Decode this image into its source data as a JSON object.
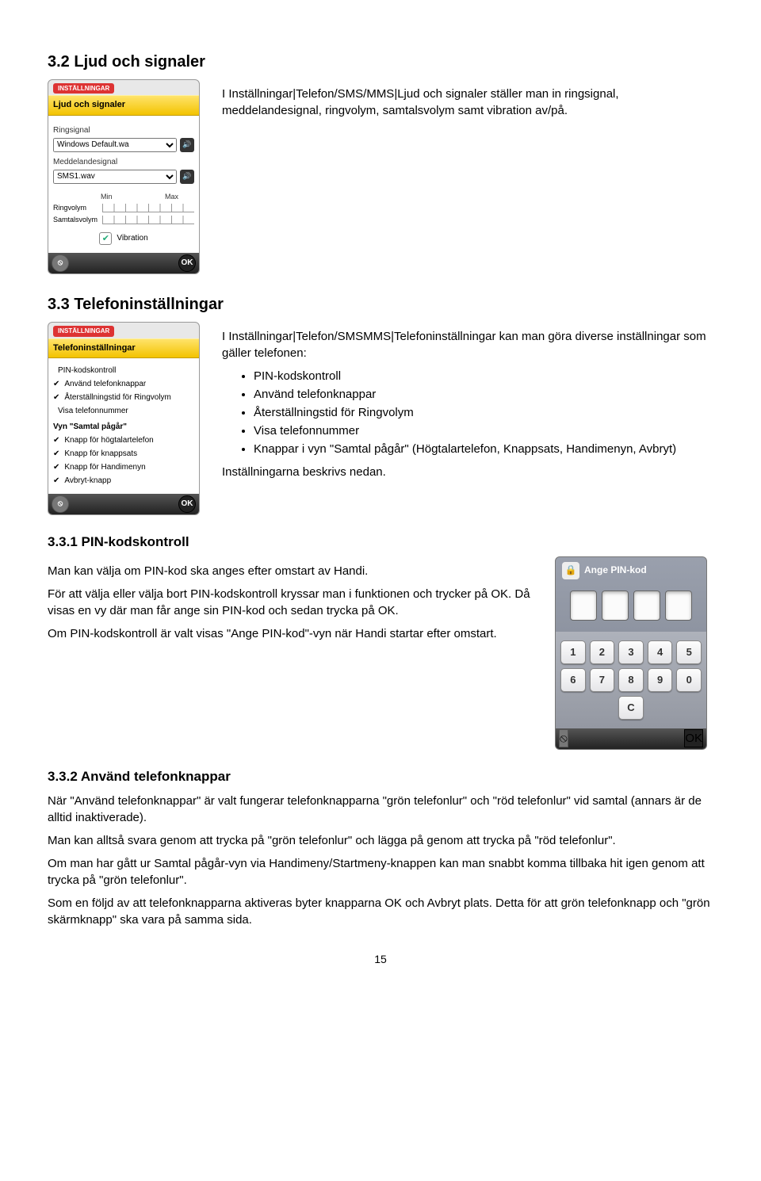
{
  "sec32": {
    "heading": "3.2 Ljud och signaler",
    "p1": "I Inställningar|Telefon/SMS/MMS|Ljud och signaler ställer man in ringsignal, meddelandesignal, ringvolym, samtalsvolym samt vibration av/på.",
    "phone": {
      "badge": "INSTÄLLNINGAR",
      "title": "Ljud och signaler",
      "ringsignal_label": "Ringsignal",
      "ringsignal_value": "Windows Default.wa",
      "meddelande_label": "Meddelandesignal",
      "meddelande_value": "SMS1.wav",
      "min": "Min",
      "max": "Max",
      "ringvolym": "Ringvolym",
      "samtalsvolym": "Samtalsvolym",
      "vibration": "Vibration",
      "ok": "OK"
    }
  },
  "sec33": {
    "heading": "3.3 Telefoninställningar",
    "p1": "I Inställningar|Telefon/SMSMMS|Telefoninställningar kan man göra diverse inställningar som gäller telefonen:",
    "bullets": [
      "PIN-kodskontroll",
      "Använd telefonknappar",
      "Återställningstid för Ringvolym",
      "Visa telefonnummer",
      "Knappar i vyn \"Samtal pågår\" (Högtalartelefon, Knappsats, Handimenyn, Avbryt)"
    ],
    "p2": "Inställningarna beskrivs nedan.",
    "phone": {
      "badge": "INSTÄLLNINGAR",
      "title": "Telefoninställningar",
      "items": [
        "PIN-kodskontroll",
        "Använd telefonknappar",
        "Återställningstid för Ringvolym",
        "Visa telefonnummer"
      ],
      "subhead": "Vyn \"Samtal pågår\"",
      "subitems": [
        "Knapp för högtalartelefon",
        "Knapp för knappsats",
        "Knapp för Handimenyn",
        "Avbryt-knapp"
      ],
      "ok": "OK"
    }
  },
  "sec331": {
    "heading": "3.3.1 PIN-kodskontroll",
    "p1": "Man kan välja om PIN-kod ska anges efter omstart av Handi.",
    "p2": "För att välja eller välja bort PIN-kodskontroll kryssar man i funktionen och trycker på OK. Då visas en vy där man får ange sin PIN-kod och sedan trycka på OK.",
    "p3": "Om PIN-kodskontroll är valt visas \"Ange PIN-kod\"-vyn när Handi startar efter omstart.",
    "pin": {
      "title": "Ange PIN-kod",
      "keys": [
        "1",
        "2",
        "3",
        "4",
        "5",
        "6",
        "7",
        "8",
        "9",
        "0",
        "C"
      ],
      "ok": "OK"
    }
  },
  "sec332": {
    "heading": "3.3.2 Använd telefonknappar",
    "p1": "När \"Använd telefonknappar\" är valt fungerar telefonknapparna \"grön telefonlur\" och \"röd telefonlur\" vid samtal (annars är de alltid inaktiverade).",
    "p2": "Man kan alltså svara genom att trycka på \"grön telefonlur\" och lägga på genom att trycka på \"röd telefonlur\".",
    "p3": "Om man har gått ur Samtal pågår-vyn via Handimeny/Startmeny-knappen kan man snabbt komma tillbaka hit igen genom att trycka på \"grön telefonlur\".",
    "p4": "Som en följd av att telefonknapparna aktiveras byter knapparna OK och Avbryt plats. Detta för att grön telefonknapp och \"grön skärmknapp\" ska vara på samma sida."
  },
  "page": "15"
}
